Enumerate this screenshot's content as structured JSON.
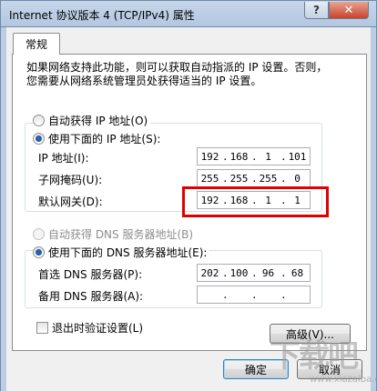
{
  "window": {
    "title": "Internet 协议版本 4 (TCP/IPv4) 属性",
    "help_label": "?",
    "close_label": "✕"
  },
  "tabs": [
    {
      "label": "常规",
      "selected": true
    }
  ],
  "description": {
    "line1": "如果网络支持此功能，则可以获取自动指派的 IP 设置。否则，",
    "line2": "您需要从网络系统管理员处获得适当的 IP 设置。"
  },
  "ip_section": {
    "auto_label": "自动获得 IP 地址(O)",
    "auto_checked": false,
    "manual_label": "使用下面的 IP 地址(S):",
    "manual_checked": true,
    "fields": [
      {
        "label": "IP 地址(I):",
        "octets": [
          "192",
          "168",
          "1",
          "101"
        ]
      },
      {
        "label": "子网掩码(U):",
        "octets": [
          "255",
          "255",
          "255",
          "0"
        ]
      },
      {
        "label": "默认网关(D):",
        "octets": [
          "192",
          "168",
          "1",
          "1"
        ]
      }
    ]
  },
  "dns_section": {
    "auto_label": "自动获得 DNS 服务器地址(B)",
    "auto_checked": false,
    "auto_disabled": true,
    "manual_label": "使用下面的 DNS 服务器地址(E):",
    "manual_checked": true,
    "fields": [
      {
        "label": "首选 DNS 服务器(P):",
        "octets": [
          "202",
          "100",
          "96",
          "68"
        ]
      },
      {
        "label": "备用 DNS 服务器(A):",
        "octets": [
          "",
          "",
          "",
          ""
        ]
      }
    ]
  },
  "validate_checkbox": {
    "label": "退出时验证设置(L)",
    "checked": false
  },
  "buttons": {
    "advanced": "高级(V)...",
    "ok": "确定",
    "cancel": "取消"
  },
  "watermark": {
    "text": "下载吧",
    "sub": "www.xiazaiba.com"
  },
  "colors": {
    "highlight_box": "#e00000",
    "radio_dot": "#2d6bc1",
    "titlebar": "#c6d6ea"
  }
}
